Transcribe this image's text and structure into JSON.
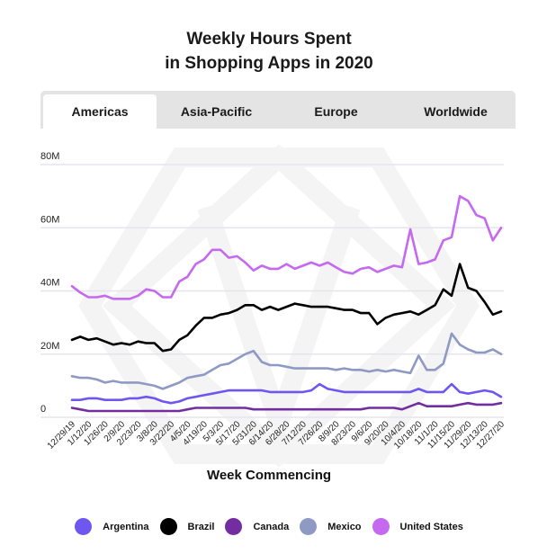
{
  "title_line1": "Weekly Hours Spent",
  "title_line2": "in Shopping Apps in 2020",
  "tabs": [
    {
      "label": "Americas",
      "active": true
    },
    {
      "label": "Asia-Pacific",
      "active": false
    },
    {
      "label": "Europe",
      "active": false
    },
    {
      "label": "Worldwide",
      "active": false
    }
  ],
  "chart_data": {
    "type": "line",
    "title": "Weekly Hours Spent in Shopping Apps in 2020",
    "xlabel": "Week Commencing",
    "ylabel": "",
    "ylim": [
      0,
      80
    ],
    "yticks": [
      0,
      20,
      40,
      60,
      80
    ],
    "ytick_labels": [
      "0",
      "20M",
      "40M",
      "60M",
      "80M"
    ],
    "grid": true,
    "legend_position": "bottom",
    "x": [
      "12/29/19",
      "1/5/20",
      "1/12/20",
      "1/19/20",
      "1/26/20",
      "2/2/20",
      "2/9/20",
      "2/16/20",
      "2/23/20",
      "3/1/20",
      "3/8/20",
      "3/15/20",
      "3/22/20",
      "3/29/20",
      "4/5/20",
      "4/12/20",
      "4/19/20",
      "4/26/20",
      "5/3/20",
      "5/10/20",
      "5/17/20",
      "5/24/20",
      "5/31/20",
      "6/7/20",
      "6/14/20",
      "6/21/20",
      "6/28/20",
      "7/5/20",
      "7/12/20",
      "7/19/20",
      "7/26/20",
      "8/2/20",
      "8/9/20",
      "8/16/20",
      "8/23/20",
      "8/30/20",
      "9/6/20",
      "9/13/20",
      "9/20/20",
      "9/27/20",
      "10/4/20",
      "10/11/20",
      "10/18/20",
      "10/25/20",
      "11/1/20",
      "11/8/20",
      "11/15/20",
      "11/22/20",
      "11/29/20",
      "12/6/20",
      "12/13/20",
      "12/20/20",
      "12/27/20"
    ],
    "x_tick_labels": [
      "12/29/19",
      "1/12/20",
      "1/26/20",
      "2/9/20",
      "2/23/20",
      "3/8/20",
      "3/22/20",
      "4/5/20",
      "4/19/20",
      "5/3/20",
      "5/17/20",
      "5/31/20",
      "6/14/20",
      "6/28/20",
      "7/12/20",
      "7/26/20",
      "8/9/20",
      "8/23/20",
      "9/6/20",
      "9/20/20",
      "10/4/20",
      "10/18/20",
      "11/1/20",
      "11/15/20",
      "11/29/20",
      "12/13/20",
      "12/27/20"
    ],
    "series": [
      {
        "name": "Argentina",
        "color": "#6e56f0",
        "values": [
          5.5,
          5.5,
          6,
          6,
          5.5,
          5.5,
          5.5,
          6,
          6,
          6.5,
          6,
          5,
          4.5,
          5,
          6,
          6.5,
          7,
          7.5,
          8,
          8.5,
          8.5,
          8.5,
          8.5,
          8.5,
          8,
          8,
          8,
          8,
          8,
          8.5,
          10.5,
          9,
          8.5,
          8,
          8,
          8,
          8,
          8,
          8,
          8,
          8,
          8,
          9,
          8,
          8,
          8,
          10.5,
          8,
          7.5,
          8,
          8.5,
          8,
          6.5
        ]
      },
      {
        "name": "Brazil",
        "color": "#000000",
        "values": [
          24.5,
          25.5,
          24.5,
          25,
          24,
          23,
          23.5,
          23,
          24,
          23.5,
          23.5,
          21,
          21.5,
          24.5,
          26,
          29,
          31.5,
          31.5,
          32.5,
          33,
          34,
          35.5,
          35.5,
          34,
          35,
          34,
          35,
          36,
          35.5,
          35,
          35,
          35,
          34.5,
          34,
          34,
          33,
          33,
          29.5,
          31.5,
          32.5,
          33,
          33.5,
          32.5,
          34,
          35.5,
          40.5,
          38.5,
          48.5,
          41,
          40,
          36.5,
          32.5,
          33.5
        ]
      },
      {
        "name": "Canada",
        "color": "#722ea0",
        "values": [
          3,
          2.5,
          2,
          2,
          2,
          2,
          2,
          2,
          2,
          2,
          2,
          2,
          2,
          2,
          2.5,
          3,
          3,
          3,
          3,
          3,
          3,
          3,
          2.5,
          2.5,
          2.5,
          2.5,
          2.5,
          2.5,
          2.5,
          2.5,
          2.5,
          2.5,
          2.5,
          2.5,
          2.5,
          2.5,
          3,
          3,
          3,
          3,
          2.5,
          3.5,
          4.5,
          3.5,
          3.5,
          3.5,
          3.5,
          4,
          4.5,
          4,
          4,
          4,
          4.5
        ]
      },
      {
        "name": "Mexico",
        "color": "#8e9ac4",
        "values": [
          13,
          12.5,
          12.5,
          12,
          11,
          11.5,
          11,
          11,
          11,
          10.5,
          10,
          9,
          10,
          11,
          12.5,
          13,
          13.5,
          15,
          16.5,
          17,
          18.5,
          20,
          21,
          17.5,
          16.5,
          16.5,
          16,
          15.5,
          15.5,
          15.5,
          15.5,
          15.5,
          15,
          15.5,
          15,
          15,
          14.5,
          15,
          14.5,
          15,
          14.5,
          14,
          19.5,
          15,
          15,
          17,
          26.5,
          23,
          21.5,
          20.5,
          20.5,
          21.5,
          20
        ]
      },
      {
        "name": "United States",
        "color": "#c469f0",
        "values": [
          41.5,
          39.5,
          38,
          38,
          38.5,
          37.5,
          37.5,
          37.5,
          38.5,
          40.5,
          40,
          38,
          38,
          43,
          44.5,
          48.5,
          50,
          53,
          53,
          50.5,
          51,
          49,
          46.5,
          48,
          47,
          47,
          48.5,
          47,
          48,
          49,
          48,
          49,
          47.5,
          46,
          45.5,
          47,
          47.5,
          46,
          47,
          48,
          47.5,
          59.5,
          48.5,
          49,
          50,
          56,
          57,
          70,
          68.5,
          64,
          63,
          56,
          60
        ]
      }
    ]
  }
}
